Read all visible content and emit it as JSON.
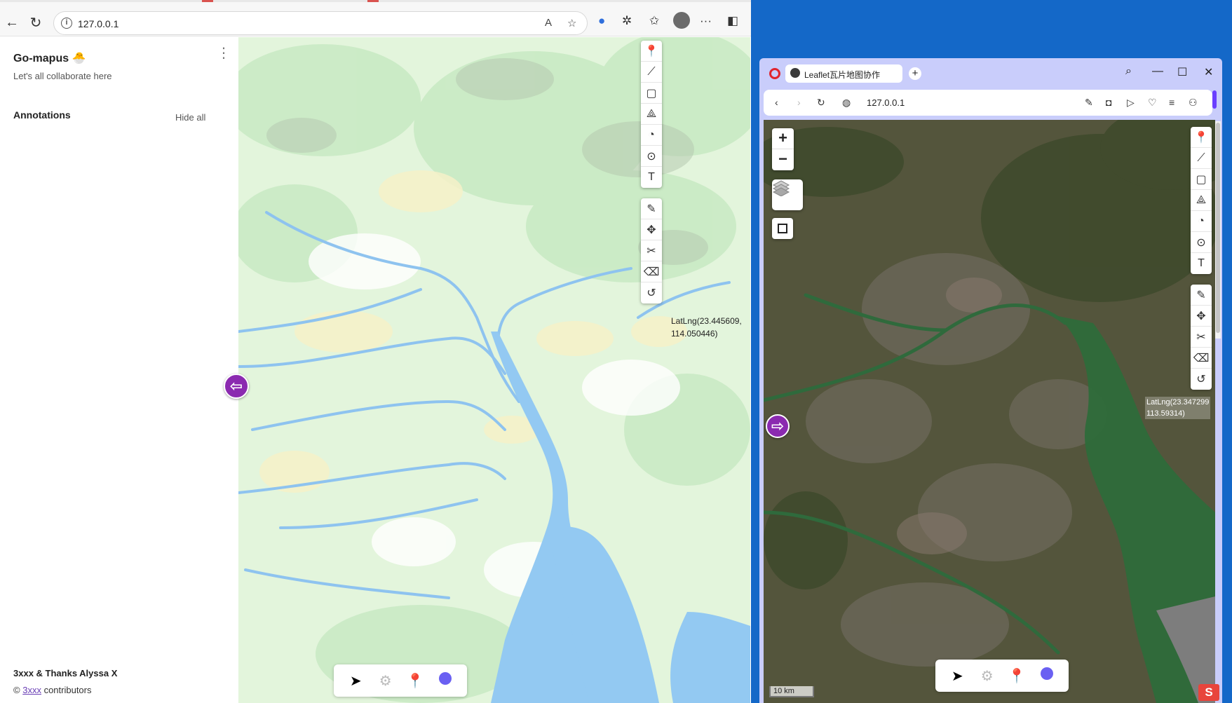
{
  "left_browser": {
    "url": "127.0.0.1",
    "sidebar": {
      "title": "Go-mapus 🐣",
      "subtitle": "Let's all collaborate here",
      "menu_icon": "⋮",
      "annotations_label": "Annotations",
      "hide_all_label": "Hide all",
      "credit_line": "3xxx & Thanks Alyssa X",
      "copyright_symbol": "©",
      "copyright_link": "3xxx",
      "copyright_suffix": " contributors"
    },
    "map": {
      "coordinate_line1": "LatLng(23.445609,",
      "coordinate_line2": "114.050446)"
    }
  },
  "right_browser": {
    "tab_title": "Leaflet瓦片地图协作",
    "url": "127.0.0.1",
    "map": {
      "coordinate_line1": "LatLng(23.347299",
      "coordinate_line2": "113.59314)",
      "scale_label": "10 km"
    }
  },
  "icons": {
    "marker": "📍",
    "line": "⟋",
    "rectangle": "▢",
    "polygon": "⟁",
    "circle_marker": "◔",
    "circle": "⊙",
    "text": "T",
    "edit": "✎",
    "drag": "✥",
    "cut": "✂",
    "erase": "⌫",
    "rotate": "↺",
    "cursor": "➤",
    "gear": "⚙",
    "pin": "📍"
  },
  "colors": {
    "purple_accent": "#8b2ab0",
    "brand_blue": "#6a60f2",
    "opera_red": "#e0242e"
  }
}
